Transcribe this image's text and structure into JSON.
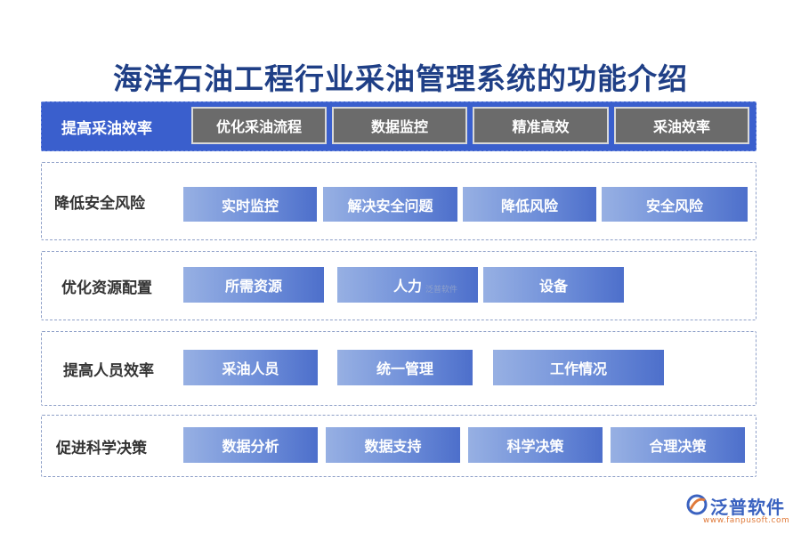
{
  "title": "海洋石油工程行业采油管理系统的功能介绍",
  "rows": [
    {
      "label": "提高采油效率",
      "items": [
        "优化采油流程",
        "数据监控",
        "精准高效",
        "采油效率"
      ]
    },
    {
      "label": "降低安全风险",
      "items": [
        "实时监控",
        "解决安全问题",
        "降低风险",
        "安全风险"
      ]
    },
    {
      "label": "优化资源配置",
      "items": [
        "所需资源",
        "人力",
        "设备"
      ]
    },
    {
      "label": "提高人员效率",
      "items": [
        "采油人员",
        "统一管理",
        "工作情况"
      ]
    },
    {
      "label": "促进科学决策",
      "items": [
        "数据分析",
        "数据支持",
        "科学决策",
        "合理决策"
      ]
    }
  ],
  "watermark": "泛普软件",
  "logo": {
    "name": "泛普软件",
    "url": "www.fanpusoft.com",
    "icon": "fanpu-logo-icon"
  },
  "colors": {
    "title": "#1f3f86",
    "highlight_row": "#3a5fcd",
    "chip_gray": "#6b6b6b",
    "chip_blue": "#5b7fd4"
  }
}
